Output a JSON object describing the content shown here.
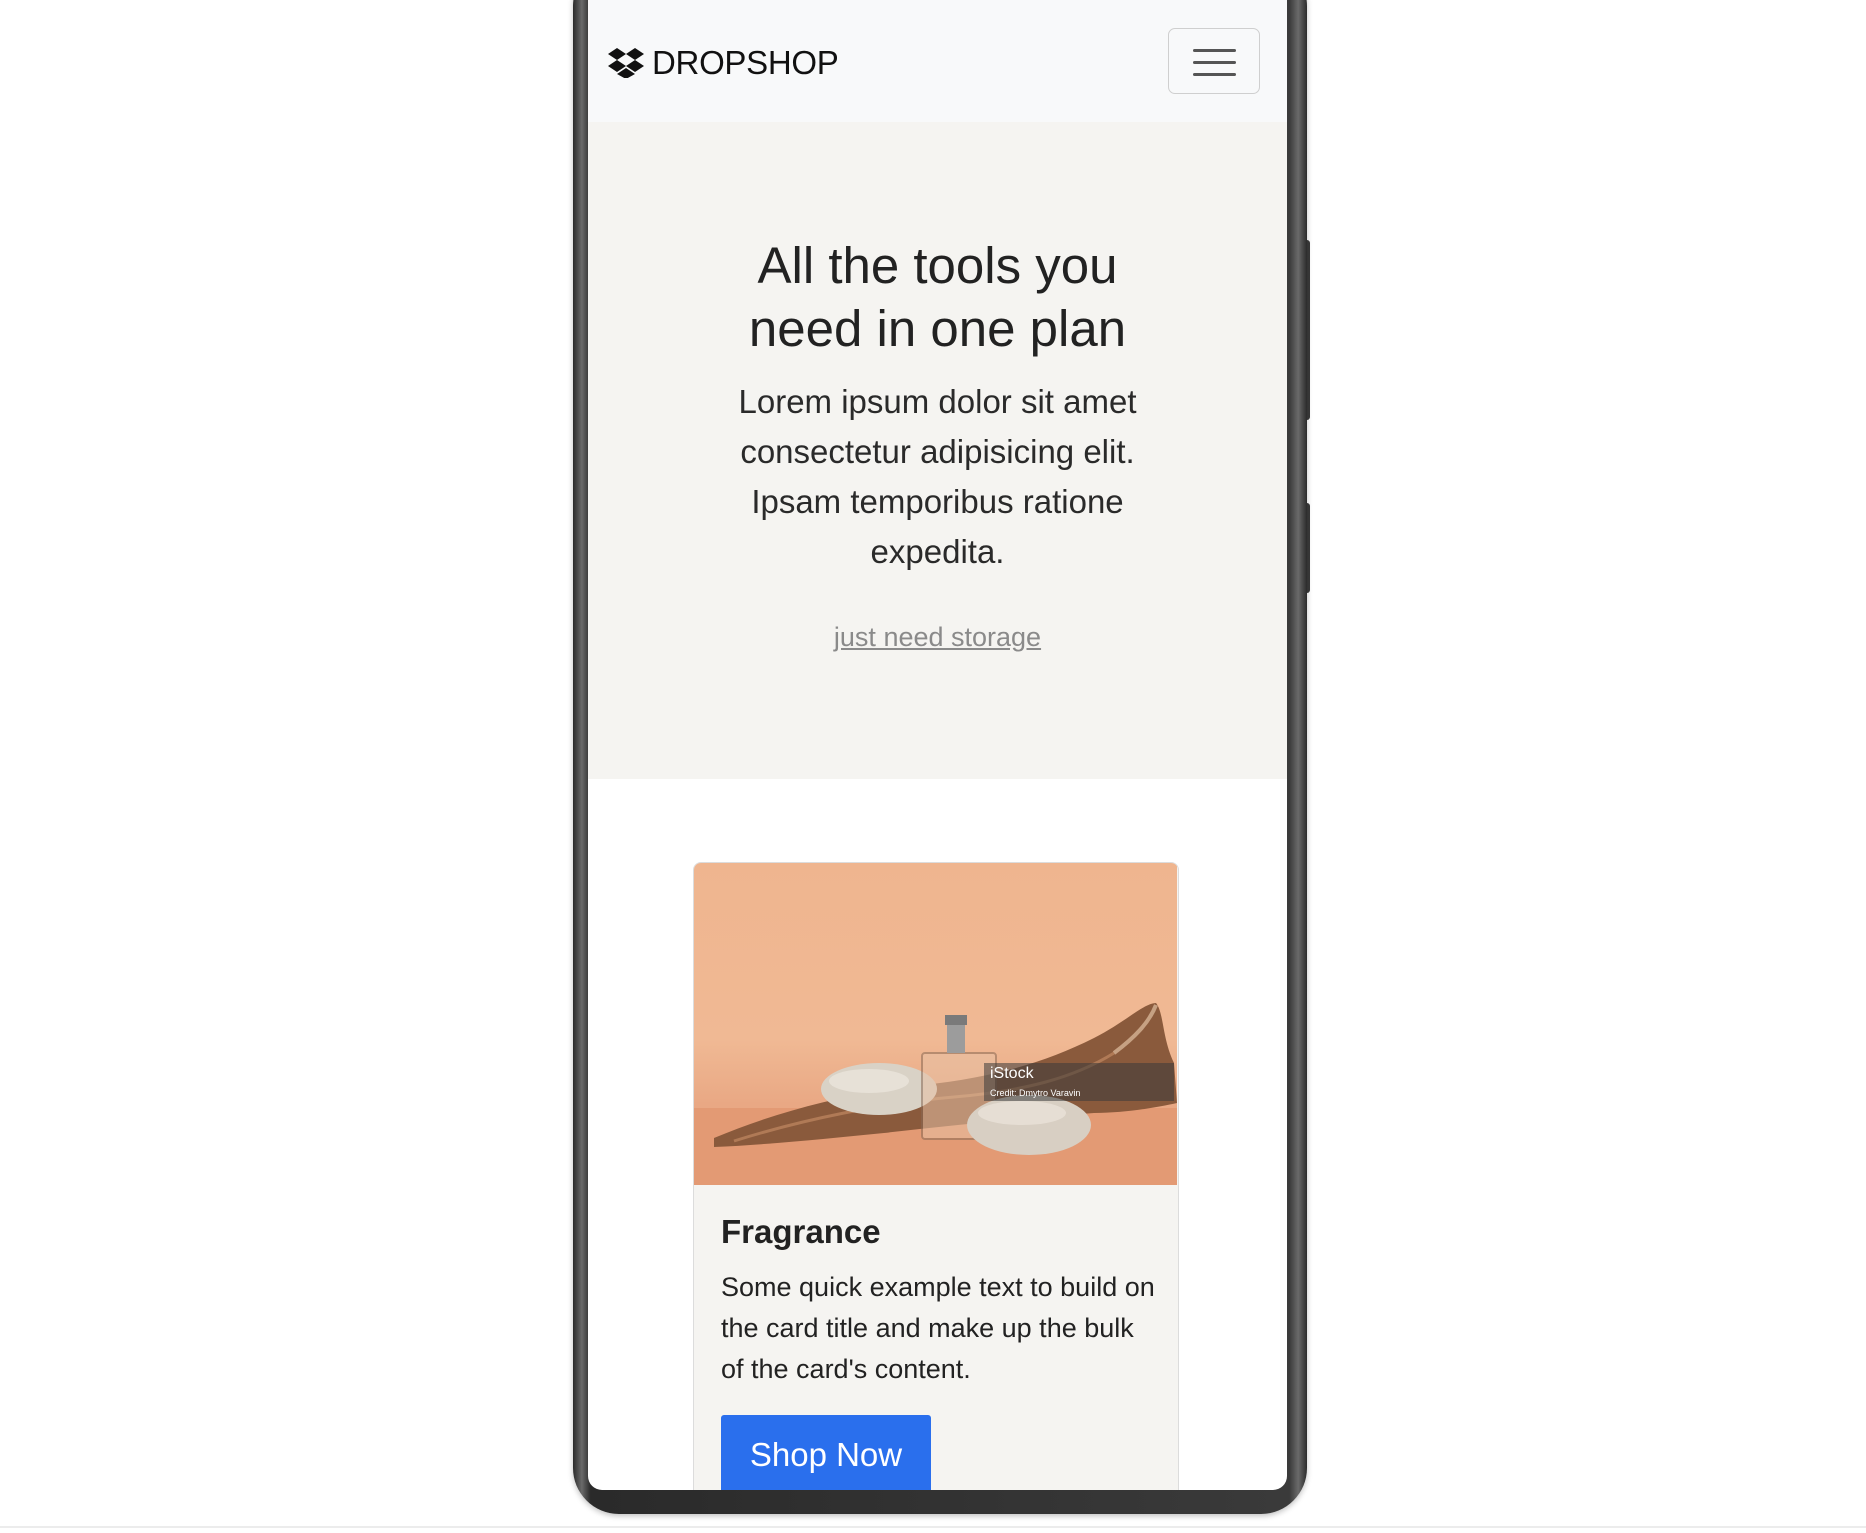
{
  "navbar": {
    "brand_name": "DROPSHOP",
    "brand_icon": "dropbox-icon",
    "menu_icon": "hamburger-menu-icon"
  },
  "hero": {
    "title_line1": "All the tools you",
    "title_line2": "need in one plan",
    "text": "Lorem ipsum dolor sit amet consectetur adipisicing elit. Ipsam temporibus ratione expedita.",
    "link": "just need storage"
  },
  "card": {
    "image_watermark": "iStock",
    "image_credit": "Credit: Dmytro Varavin",
    "title": "Fragrance",
    "text": "Some quick example text to build on the card title and make up the bulk of the card's content.",
    "button": "Shop Now"
  },
  "colors": {
    "navbar_bg": "#f8f9fa",
    "hero_bg": "#f5f4f1",
    "button_bg": "#2a6fed",
    "link_color": "#8a8a8a"
  }
}
